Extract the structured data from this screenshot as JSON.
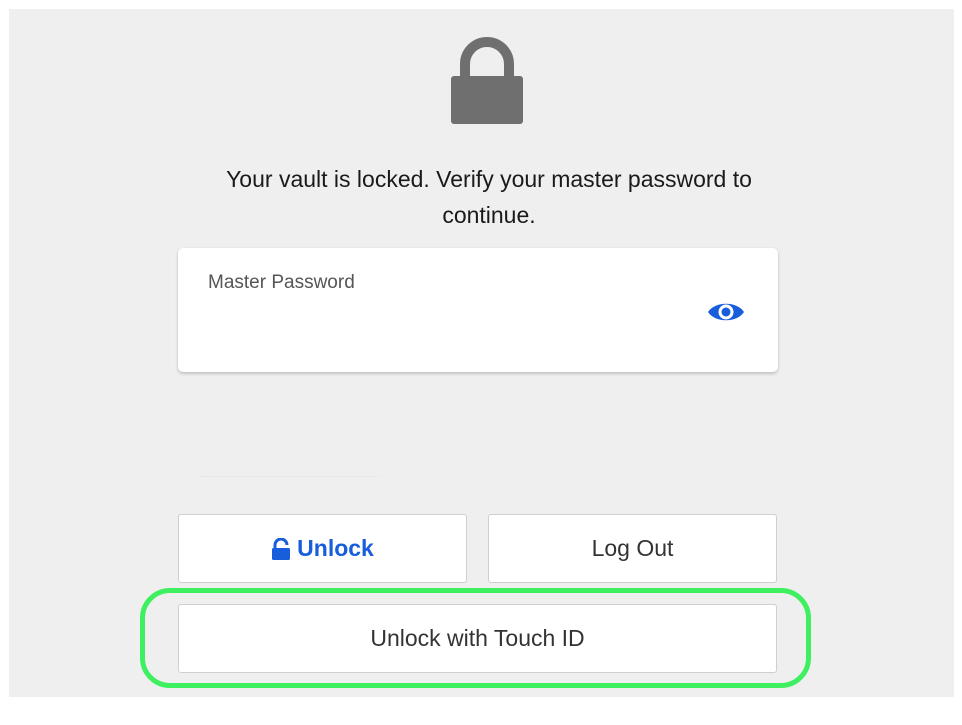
{
  "lock_screen": {
    "message": "Your vault is locked. Verify your master password to continue.",
    "password_field": {
      "label": "Master Password",
      "value": ""
    },
    "buttons": {
      "unlock_label": "Unlock",
      "logout_label": "Log Out",
      "touchid_label": "Unlock with Touch ID"
    }
  },
  "icons": {
    "lock": "lock-icon",
    "eye": "eye-icon",
    "unlock": "unlock-icon"
  },
  "colors": {
    "accent": "#175ddc",
    "panel_background": "#efefef",
    "highlight": "#3ef060",
    "lock_icon": "#6f6f6f"
  }
}
